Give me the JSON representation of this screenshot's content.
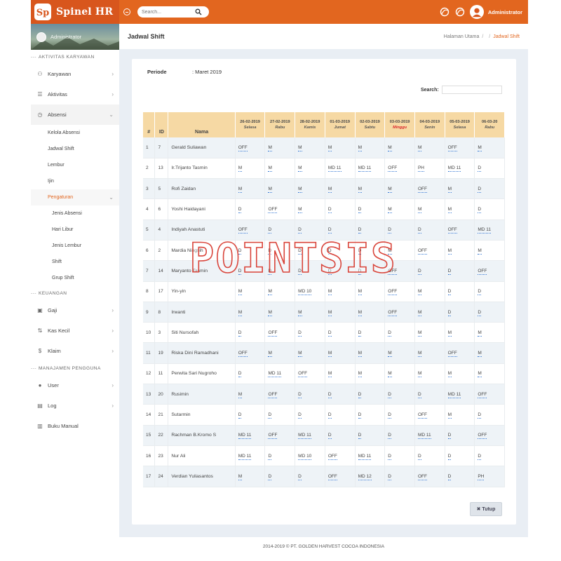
{
  "app": {
    "brand_name": "Spinel HR",
    "brand_initials": "Sp"
  },
  "topbar": {
    "search_placeholder": "Search...",
    "user_name": "Administrator"
  },
  "sidebar": {
    "profile_name": "Administrator",
    "sections": [
      {
        "title": "AKTIVITAS KARYAWAN"
      },
      {
        "title": "KEUANGAN"
      },
      {
        "title": "MANAJAMEN PENGGUNA"
      }
    ],
    "items": {
      "karyawan": "Karyawan",
      "aktivitas": "Aktivitas",
      "absensi": "Absensi",
      "kelola_absensi": "Kelola Absensi",
      "jadwal_shift": "Jadwal Shift",
      "lembur": "Lembur",
      "ijin": "Ijin",
      "pengaturan": "Pengaturan",
      "jenis_absensi": "Jenis Absensi",
      "hari_libur": "Hari Libur",
      "jenis_lembur": "Jenis Lembur",
      "shift": "Shift",
      "grup_shift": "Grup Shift",
      "gaji": "Gaji",
      "kas_kecil": "Kas Kecil",
      "klaim": "Klaim",
      "user": "User",
      "log": "Log",
      "buku_manual": "Buku Manual"
    }
  },
  "page": {
    "title": "Jadwal Shift",
    "breadcrumb": {
      "home": "Halaman Utama",
      "separator": "/",
      "current": "Jadwal Shift"
    },
    "period_label": "Periode",
    "period_value": ": Maret 2019",
    "search_label": "Search:",
    "close_button": "✖ Tutup",
    "watermark": "POINTSIS"
  },
  "table": {
    "headers": {
      "no": "#",
      "id": "ID",
      "name": "Nama"
    },
    "dates": [
      {
        "date": "26-02-2019",
        "day": "Selasa",
        "sunday": false
      },
      {
        "date": "27-02-2019",
        "day": "Rabu",
        "sunday": false
      },
      {
        "date": "28-02-2019",
        "day": "Kamis",
        "sunday": false
      },
      {
        "date": "01-03-2019",
        "day": "Jumat",
        "sunday": false
      },
      {
        "date": "02-03-2019",
        "day": "Sabtu",
        "sunday": false
      },
      {
        "date": "03-03-2019",
        "day": "Minggu",
        "sunday": true
      },
      {
        "date": "04-03-2019",
        "day": "Senin",
        "sunday": false
      },
      {
        "date": "05-03-2019",
        "day": "Selasa",
        "sunday": false
      },
      {
        "date": "06-03-20",
        "day": "Rabu",
        "sunday": false
      }
    ],
    "rows": [
      {
        "no": "1",
        "id": "7",
        "name": "Gerald Suliawan",
        "shifts": [
          "OFF",
          "M",
          "M",
          "M",
          "M",
          "M",
          "M",
          "OFF",
          "M"
        ]
      },
      {
        "no": "2",
        "id": "13",
        "name": "Ir.Trijanto Tasmin",
        "shifts": [
          "M",
          "M",
          "M",
          "MD 11",
          "MD 11",
          "OFF",
          "PH",
          "MD 11",
          "D"
        ]
      },
      {
        "no": "3",
        "id": "5",
        "name": "Rofi Zaidan",
        "shifts": [
          "M",
          "M",
          "M",
          "M",
          "M",
          "M",
          "OFF",
          "M",
          "D"
        ]
      },
      {
        "no": "4",
        "id": "6",
        "name": "Yoshi Haidayani",
        "shifts": [
          "D",
          "OFF",
          "M",
          "D",
          "D",
          "M",
          "M",
          "M",
          "D"
        ]
      },
      {
        "no": "5",
        "id": "4",
        "name": "Indiyah Anastuti",
        "shifts": [
          "OFF",
          "D",
          "D",
          "D",
          "D",
          "D",
          "D",
          "OFF",
          "MD 11"
        ]
      },
      {
        "no": "6",
        "id": "2",
        "name": "Mardia Ningsih",
        "shifts": [
          "D",
          "D",
          "D",
          "D",
          "D",
          "M",
          "OFF",
          "M",
          "M"
        ]
      },
      {
        "no": "7",
        "id": "14",
        "name": "Maryanto Tasmin",
        "shifts": [
          "D",
          "D",
          "D",
          "D",
          "D",
          "OFF",
          "D",
          "D",
          "OFF"
        ]
      },
      {
        "no": "8",
        "id": "17",
        "name": "Yin-yin",
        "shifts": [
          "M",
          "M",
          "MD 10",
          "M",
          "M",
          "OFF",
          "M",
          "D",
          "D"
        ]
      },
      {
        "no": "9",
        "id": "8",
        "name": "Irwanti",
        "shifts": [
          "M",
          "M",
          "M",
          "M",
          "M",
          "OFF",
          "M",
          "D",
          "D"
        ]
      },
      {
        "no": "10",
        "id": "3",
        "name": "Siti Nursofah",
        "shifts": [
          "D",
          "OFF",
          "D",
          "D",
          "D",
          "D",
          "M",
          "M",
          "M"
        ]
      },
      {
        "no": "11",
        "id": "19",
        "name": "Riska Dini Ramadhani",
        "shifts": [
          "OFF",
          "M",
          "M",
          "M",
          "M",
          "M",
          "M",
          "OFF",
          "M"
        ]
      },
      {
        "no": "12",
        "id": "11",
        "name": "Perwita Sari Nugroho",
        "shifts": [
          "D",
          "MD 11",
          "OFF",
          "M",
          "M",
          "M",
          "M",
          "M",
          "M"
        ]
      },
      {
        "no": "13",
        "id": "20",
        "name": "Rusimin",
        "shifts": [
          "M",
          "OFF",
          "D",
          "D",
          "D",
          "D",
          "D",
          "MD 11",
          "OFF"
        ]
      },
      {
        "no": "14",
        "id": "21",
        "name": "Sutarmin",
        "shifts": [
          "D",
          "D",
          "D",
          "D",
          "D",
          "D",
          "OFF",
          "M",
          "D"
        ]
      },
      {
        "no": "15",
        "id": "22",
        "name": "Rachman B.Kromo S",
        "shifts": [
          "MD 11",
          "OFF",
          "MD 11",
          "D",
          "D",
          "D",
          "MD 11",
          "D",
          "OFF"
        ]
      },
      {
        "no": "16",
        "id": "23",
        "name": "Nur Ali",
        "shifts": [
          "MD 11",
          "D",
          "MD 10",
          "OFF",
          "MD 11",
          "D",
          "D",
          "D",
          "D"
        ]
      },
      {
        "no": "17",
        "id": "24",
        "name": "Verdian Yuliasantos",
        "shifts": [
          "M",
          "D",
          "D",
          "OFF",
          "MD 12",
          "D",
          "OFF",
          "D",
          "PH"
        ]
      }
    ]
  },
  "footer": {
    "text": "2014-2019 © PT. GOLDEN HARVEST COCOA INDONESIA"
  },
  "colors": {
    "brand": "#d8561d",
    "topbar": "#e2661f",
    "header_row": "#f6d9a4",
    "sunday": "#d9262b",
    "accent": "#e2661f"
  }
}
